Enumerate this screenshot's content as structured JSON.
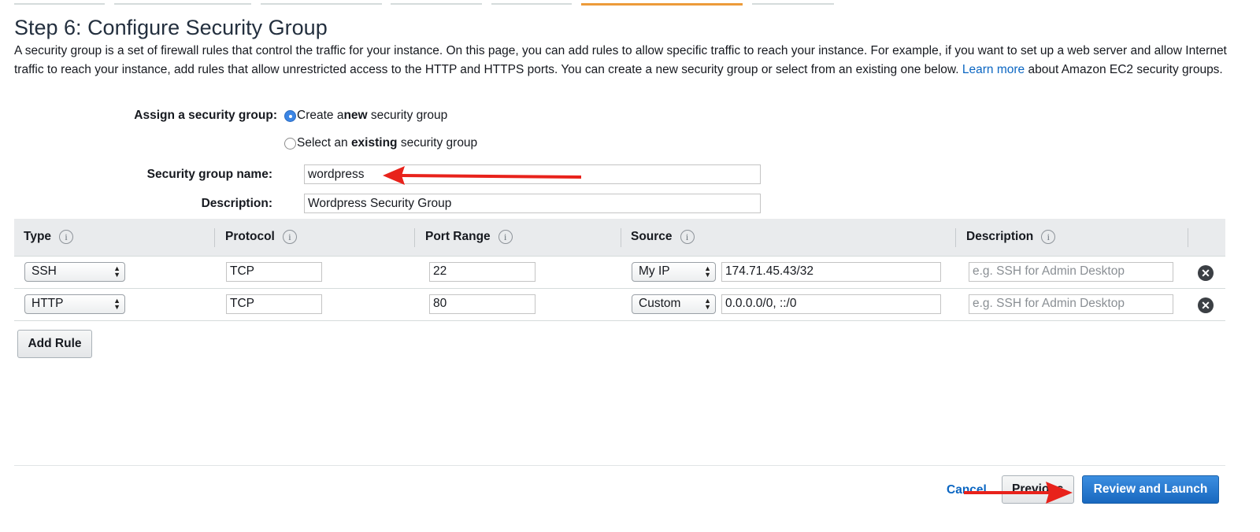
{
  "page": {
    "title": "Step 6: Configure Security Group",
    "intro_text": "A security group is a set of firewall rules that control the traffic for your instance. On this page, you can add rules to allow specific traffic to reach your instance. For example, if you want to set up a web server and allow Internet traffic to reach your instance, add rules that allow unrestricted access to the HTTP and HTTPS ports. You can create a new security group or select from an existing one below.",
    "learn_more_link": "Learn more",
    "intro_suffix": "about Amazon EC2 security groups."
  },
  "assign": {
    "label": "Assign a security group:",
    "option_new": {
      "prefix": "Create a ",
      "bold": "new",
      "suffix": " security group",
      "selected": true
    },
    "option_existing": {
      "prefix": "Select an ",
      "bold": "existing",
      "suffix": " security group",
      "selected": false
    }
  },
  "form": {
    "name_label": "Security group name:",
    "name_value": "wordpress",
    "description_label": "Description:",
    "description_value": "Wordpress Security Group"
  },
  "table": {
    "columns": [
      "Type",
      "Protocol",
      "Port Range",
      "Source",
      "Description"
    ],
    "info_glyph": "i",
    "remove_glyph": "✕",
    "rows": [
      {
        "type": "SSH",
        "protocol": "TCP",
        "port_range": "22",
        "source_mode": "My IP",
        "source_value": "174.71.45.43/32",
        "description_placeholder": "e.g. SSH for Admin Desktop"
      },
      {
        "type": "HTTP",
        "protocol": "TCP",
        "port_range": "80",
        "source_mode": "Custom",
        "source_value": "0.0.0.0/0, ::/0",
        "description_placeholder": "e.g. SSH for Admin Desktop"
      }
    ]
  },
  "buttons": {
    "add_rule": "Add Rule",
    "cancel": "Cancel",
    "previous": "Previous",
    "review_launch": "Review and Launch"
  },
  "icons": {
    "info": "info-icon",
    "remove": "remove-row-icon",
    "select_arrows": "updown-arrows-icon"
  },
  "colors": {
    "accent_tab": "#ec9b3a",
    "link": "#0b66c2",
    "primary_button": "#1f73cc",
    "annotation_arrow": "#e8221b"
  }
}
